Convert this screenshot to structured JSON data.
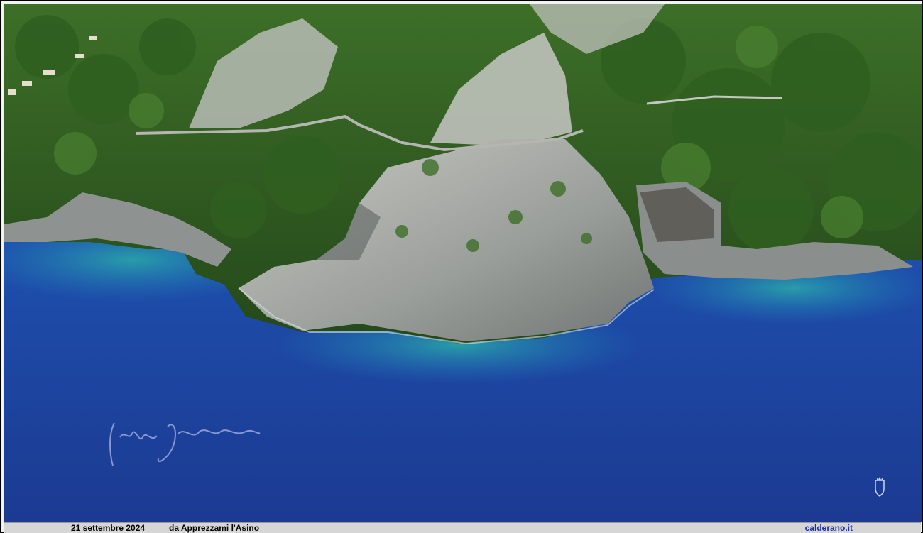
{
  "caption": {
    "date": "21 settembre 2024",
    "title": "da Apprezzami l'Asino",
    "site": "calderano.it"
  },
  "colors": {
    "sea_deep": "#1c3c98",
    "sea_mid": "#1e58b8",
    "sea_shallow": "#1f93a8",
    "forest": "#2e5a1e",
    "rock": "#a8acaa",
    "caption_bar": "#d6d6d6",
    "site_link": "#1a2fb8"
  },
  "icons": {
    "signature": "handwritten-signature",
    "crest": "coat-of-arms-crest"
  }
}
